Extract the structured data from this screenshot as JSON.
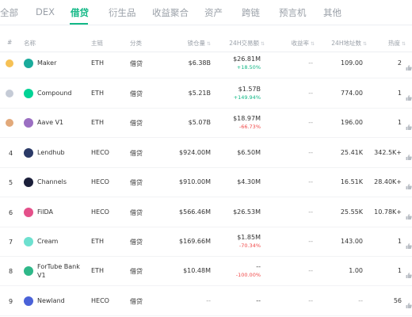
{
  "tabs": [
    {
      "label": "全部",
      "active": false
    },
    {
      "label": "DEX",
      "active": false
    },
    {
      "label": "借贷",
      "active": true
    },
    {
      "label": "衍生品",
      "active": false
    },
    {
      "label": "收益聚合",
      "active": false
    },
    {
      "label": "资产",
      "active": false
    },
    {
      "label": "跨链",
      "active": false
    },
    {
      "label": "预言机",
      "active": false
    },
    {
      "label": "其他",
      "active": false
    }
  ],
  "table": {
    "headers": {
      "rank": "#",
      "name": "名称",
      "chain": "主链",
      "category": "分类",
      "locked": "锁仓量",
      "volume": "24H交易额",
      "yield": "收益率",
      "addresses": "24H地址数",
      "hot": "热度"
    },
    "sort_icon": "⇅",
    "rows": [
      {
        "rank": "",
        "medal": "gold",
        "name": "Maker",
        "logo_color": "#1aab9b",
        "chain": "ETH",
        "category": "借贷",
        "locked": "$6.38B",
        "volume": "$26.81M",
        "change": "+18.50%",
        "change_dir": "up",
        "yield": "--",
        "addresses": "109.00",
        "hot": "2"
      },
      {
        "rank": "",
        "medal": "silver",
        "name": "Compound",
        "logo_color": "#00d395",
        "chain": "ETH",
        "category": "借贷",
        "locked": "$5.21B",
        "volume": "$1.57B",
        "change": "+149.94%",
        "change_dir": "up",
        "yield": "--",
        "addresses": "774.00",
        "hot": "1"
      },
      {
        "rank": "",
        "medal": "bronze",
        "name": "Aave V1",
        "logo_color": "#9b6fc2",
        "chain": "ETH",
        "category": "借贷",
        "locked": "$5.07B",
        "volume": "$18.97M",
        "change": "-66.73%",
        "change_dir": "down",
        "yield": "--",
        "addresses": "196.00",
        "hot": "1"
      },
      {
        "rank": "4",
        "medal": "",
        "name": "Lendhub",
        "logo_color": "#2b3a67",
        "chain": "HECO",
        "category": "借贷",
        "locked": "$924.00M",
        "volume": "$6.50M",
        "change": "",
        "change_dir": "",
        "yield": "--",
        "addresses": "25.41K",
        "hot": "342.5K+"
      },
      {
        "rank": "5",
        "medal": "",
        "name": "Channels",
        "logo_color": "#1b1f3a",
        "chain": "HECO",
        "category": "借贷",
        "locked": "$910.00M",
        "volume": "$4.30M",
        "change": "",
        "change_dir": "",
        "yield": "--",
        "addresses": "16.51K",
        "hot": "28.40K+"
      },
      {
        "rank": "6",
        "medal": "",
        "name": "FilDA",
        "logo_color": "#e4508a",
        "chain": "HECO",
        "category": "借贷",
        "locked": "$566.46M",
        "volume": "$26.53M",
        "change": "",
        "change_dir": "",
        "yield": "--",
        "addresses": "25.55K",
        "hot": "10.78K+"
      },
      {
        "rank": "7",
        "medal": "",
        "name": "Cream",
        "logo_color": "#6de0cf",
        "chain": "ETH",
        "category": "借贷",
        "locked": "$169.66M",
        "volume": "$1.85M",
        "change": "-70.34%",
        "change_dir": "down",
        "yield": "--",
        "addresses": "143.00",
        "hot": "1"
      },
      {
        "rank": "8",
        "medal": "",
        "name": "ForTube Bank V1",
        "logo_color": "#2fb889",
        "chain": "ETH",
        "category": "借贷",
        "locked": "$10.48M",
        "volume": "--",
        "change": "-100.00%",
        "change_dir": "down",
        "yield": "--",
        "addresses": "1.00",
        "hot": "1"
      },
      {
        "rank": "9",
        "medal": "",
        "name": "Newland",
        "logo_color": "#4a62d8",
        "chain": "HECO",
        "category": "借贷",
        "locked": "--",
        "volume": "--",
        "change": "",
        "change_dir": "",
        "yield": "--",
        "addresses": "--",
        "hot": "56"
      }
    ]
  },
  "icons": {
    "thumb": "thumbs-up-icon",
    "sort": "sort-icon",
    "medal": "medal-icon"
  }
}
